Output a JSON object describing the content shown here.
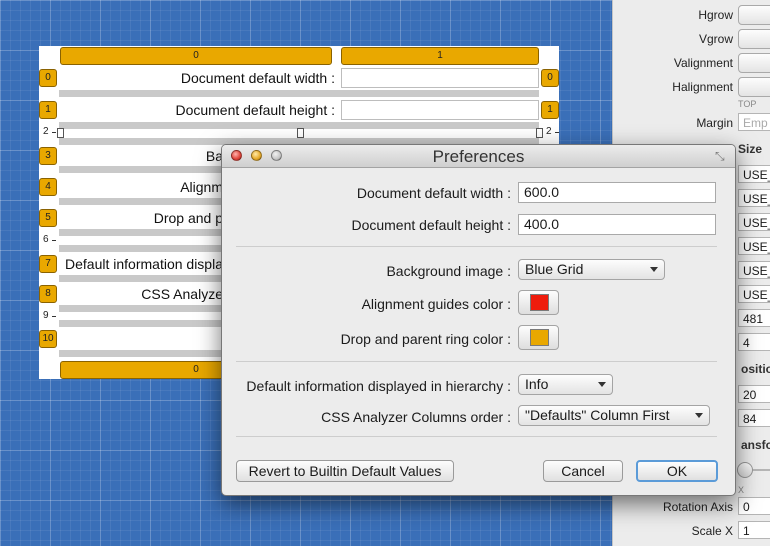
{
  "grid": {
    "col_headers": [
      "0",
      "1"
    ],
    "footer_header": "0",
    "row_indices": [
      "0",
      "1",
      "2",
      "3",
      "4",
      "5",
      "6",
      "7",
      "8",
      "9",
      "10"
    ],
    "right_badges": [
      "0",
      "1"
    ],
    "right_line": "2",
    "labels": [
      "Document default width :",
      "Document default height :",
      "Ba",
      "Alignm",
      "Drop and p",
      "Default information displa",
      "CSS Analyze"
    ]
  },
  "inspector": {
    "labels": [
      "Hgrow",
      "Vgrow",
      "Valignment",
      "Halignment",
      "Margin"
    ],
    "top_caption": "TOP",
    "margin_placeholder": "Emp",
    "size_heading": "Size",
    "size_values": [
      "USE_C",
      "USE_C",
      "USE_C",
      "USE_C",
      "USE_C",
      "USE_C",
      "481",
      "4"
    ],
    "position_heading": "ositio",
    "position_values": [
      "20",
      "84"
    ],
    "transform_heading": "ansfor",
    "x_caption": "X",
    "rotation_axis_label": "Rotation Axis",
    "rotation_axis_value": "0",
    "scale_x_label": "Scale X",
    "scale_x_value": "1"
  },
  "dialog": {
    "title": "Preferences",
    "width_label": "Document default width :",
    "width_value": "600.0",
    "height_label": "Document default height :",
    "height_value": "400.0",
    "bg_image_label": "Background image :",
    "bg_image_value": "Blue Grid",
    "align_color_label": "Alignment guides color :",
    "align_color": "#ee1c0c",
    "ring_color_label": "Drop and parent ring color :",
    "ring_color": "#e9a800",
    "hierarchy_label": "Default information displayed in hierarchy :",
    "hierarchy_value": "Info",
    "css_order_label": "CSS Analyzer Columns order :",
    "css_order_value": "\"Defaults\" Column First",
    "revert_label": "Revert to Builtin Default Values",
    "cancel_label": "Cancel",
    "ok_label": "OK"
  },
  "icons": {
    "close": "close-icon",
    "minimize": "minimize-icon",
    "zoom": "zoom-icon",
    "resize": "resize-icon",
    "dropdown": "chevron-down-icon"
  },
  "colors": {
    "accent_gold": "#e9a800",
    "background_blue": "#3a6fb8",
    "ok_focus": "#5b9bd8"
  }
}
